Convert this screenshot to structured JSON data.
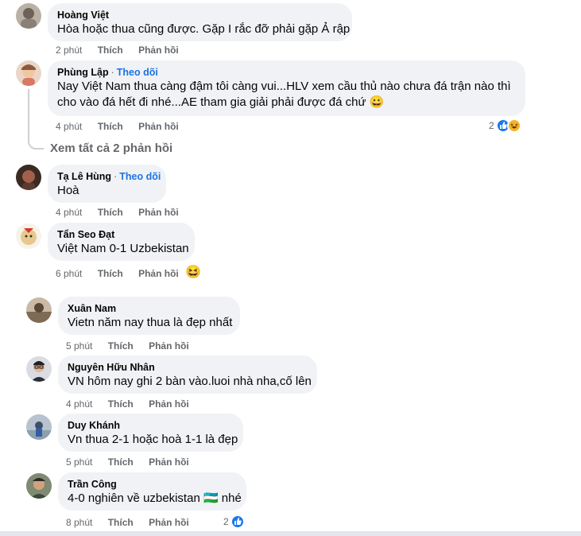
{
  "comments": [
    {
      "name": "Hoàng Việt",
      "text": "Hòa hoặc thua cũng được. Gặp I rắc đỡ phải gặp Ả rập",
      "time": "2 phút",
      "like": "Thích",
      "reply": "Phản hồi"
    },
    {
      "name": "Phùng Lập",
      "follow": "Theo dõi",
      "line1": "Nay Việt Nam thua càng đậm tôi càng vui...HLV xem cầu thủ nào chưa đá trận nào thì",
      "line2": "cho vào đá hết đi nhé...AE tham gia giải phải được đá chứ 😀",
      "time": "4 phút",
      "like": "Thích",
      "reply": "Phản hồi",
      "reactions": "2"
    },
    {
      "name": "Tạ Lê Hùng",
      "follow": "Theo dõi",
      "text": "Hoà",
      "time": "4 phút",
      "like": "Thích",
      "reply": "Phản hồi"
    },
    {
      "name": "Tẩn Seo Đạt",
      "text": "Việt Nam 0-1 Uzbekistan",
      "time": "6 phút",
      "like": "Thích",
      "reply": "Phản hồi",
      "emoji": "😆"
    }
  ],
  "view_replies": "Xem tất cả 2 phản hồi",
  "replies": [
    {
      "name": "Xuân Nam",
      "text": "Vietn năm nay thua là đẹp nhất",
      "time": "5 phút",
      "like": "Thích",
      "reply": "Phản hồi"
    },
    {
      "name": "Nguyên Hữu Nhân",
      "text": "VN hôm nay ghi 2 bàn vào.luoi nhà nha,cố lên",
      "time": "4 phút",
      "like": "Thích",
      "reply": "Phản hồi"
    },
    {
      "name": "Duy Khánh",
      "text": "Vn thua 2-1 hoặc hoà 1-1 là đẹp",
      "time": "5 phút",
      "like": "Thích",
      "reply": "Phản hồi"
    },
    {
      "name": "Trần Công",
      "text": "4-0 nghiên về uzbekistan 🇺🇿 nhé",
      "time": "8 phút",
      "like": "Thích",
      "reply": "Phản hồi",
      "reactions": "2"
    }
  ],
  "dot": "·",
  "colors": {
    "accent": "#1b74e4",
    "bubble": "#f0f2f5",
    "meta": "#65676b"
  }
}
